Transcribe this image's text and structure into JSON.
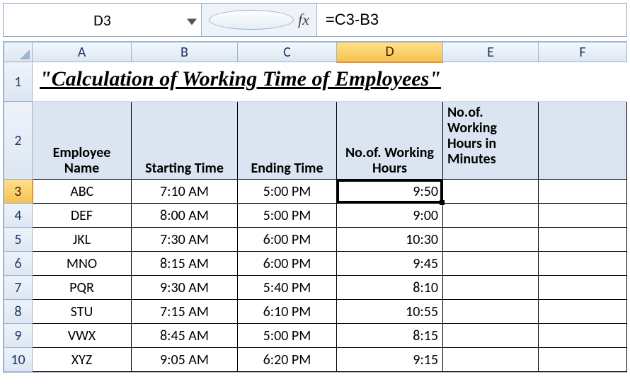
{
  "formula_bar": {
    "name_box": "D3",
    "fx_label": "fx",
    "formula": "=C3-B3"
  },
  "columns": [
    "A",
    "B",
    "C",
    "D",
    "E",
    "F"
  ],
  "selected_col": "D",
  "selected_row": "3",
  "title_row": {
    "num": "1",
    "text": "\"Calculation of Working Time of Employees\""
  },
  "header_row": {
    "num": "2",
    "cells": {
      "A": "Employee Name",
      "B": "Starting Time",
      "C": "Ending Time",
      "D": "No.of. Working Hours",
      "E": "No.of. Working Hours in Minutes"
    }
  },
  "data_rows": [
    {
      "num": "3",
      "A": "ABC",
      "B": "7:10 AM",
      "C": "5:00 PM",
      "D": "9:50"
    },
    {
      "num": "4",
      "A": "DEF",
      "B": "8:00 AM",
      "C": "5:00 PM",
      "D": "9:00"
    },
    {
      "num": "5",
      "A": "JKL",
      "B": "7:30 AM",
      "C": "6:00 PM",
      "D": "10:30"
    },
    {
      "num": "6",
      "A": "MNO",
      "B": "8:15 AM",
      "C": "6:00 PM",
      "D": "9:45"
    },
    {
      "num": "7",
      "A": "PQR",
      "B": "9:30 AM",
      "C": "5:40 PM",
      "D": "8:10"
    },
    {
      "num": "8",
      "A": "STU",
      "B": "7:15 AM",
      "C": "6:10 PM",
      "D": "10:55"
    },
    {
      "num": "9",
      "A": "VWX",
      "B": "8:45 AM",
      "C": "5:00 PM",
      "D": "8:15"
    },
    {
      "num": "10",
      "A": "XYZ",
      "B": "9:05 AM",
      "C": "6:20 PM",
      "D": "9:15"
    }
  ]
}
